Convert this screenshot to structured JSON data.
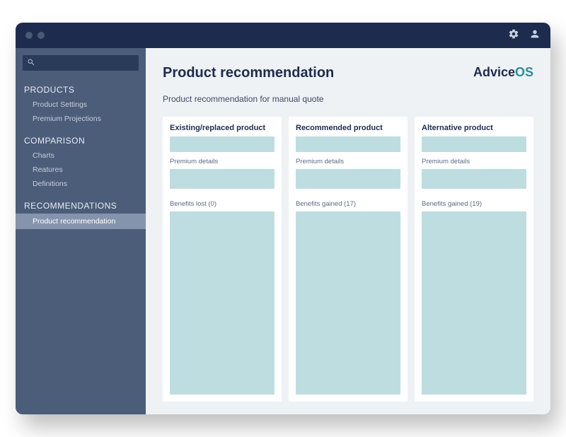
{
  "brand": {
    "part1": "Advice",
    "part2": "OS"
  },
  "page": {
    "title": "Product recommendation",
    "subtitle": "Product recommendation for manual quote"
  },
  "sidebar": {
    "sections": [
      {
        "title": "PRODUCTS",
        "items": [
          {
            "label": "Product Settings",
            "active": false
          },
          {
            "label": "Premium Projections",
            "active": false
          }
        ]
      },
      {
        "title": "COMPARISON",
        "items": [
          {
            "label": "Charts",
            "active": false
          },
          {
            "label": "Reatures",
            "active": false
          },
          {
            "label": "Definitions",
            "active": false
          }
        ]
      },
      {
        "title": "RECOMMENDATIONS",
        "items": [
          {
            "label": "Product recommendation",
            "active": true
          }
        ]
      }
    ]
  },
  "columns": [
    {
      "title": "Existing/replaced product",
      "premium_label": "Premium details",
      "benefits_label": "Benefits lost (0)"
    },
    {
      "title": "Recommended product",
      "premium_label": "Premium details",
      "benefits_label": "Benefits gained (17)"
    },
    {
      "title": "Alternative product",
      "premium_label": "Premium details",
      "benefits_label": "Benefits gained (19)"
    }
  ]
}
